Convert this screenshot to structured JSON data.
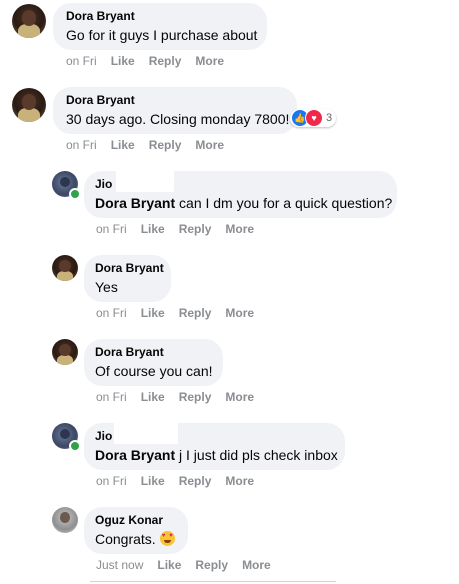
{
  "actions": {
    "like": "Like",
    "reply": "Reply",
    "more": "More"
  },
  "comments": [
    {
      "author": "Dora Bryant",
      "text": "Go for it guys I purchase about",
      "time": "on Fri"
    },
    {
      "author": "Dora Bryant",
      "text": "30 days ago. Closing monday 7800!",
      "time": "on Fri",
      "reactions": {
        "count": "3",
        "types": [
          "like",
          "love"
        ]
      }
    },
    {
      "author": "Jio",
      "mention": "Dora Bryant",
      "text": "can I dm you for a quick question?",
      "time": "on Fri"
    },
    {
      "author": "Dora Bryant",
      "text": "Yes",
      "time": "on Fri"
    },
    {
      "author": "Dora Bryant",
      "text": "Of course you can!",
      "time": "on Fri"
    },
    {
      "author": "Jio",
      "mention": "Dora Bryant",
      "text": "j I just did pls check inbox",
      "time": "on Fri"
    },
    {
      "author": "Oguz Konar",
      "text": "Congrats.",
      "emoji": "heart-eyes-emoji",
      "time": "Just now"
    }
  ],
  "icons": {
    "like_reaction": "thumbs-up-icon",
    "love_reaction": "heart-icon"
  },
  "colors": {
    "bubble": "#f0f2f5",
    "meta_text": "#8a8d91",
    "like": "#1877f2",
    "love": "#f02849",
    "online": "#31a24c"
  }
}
